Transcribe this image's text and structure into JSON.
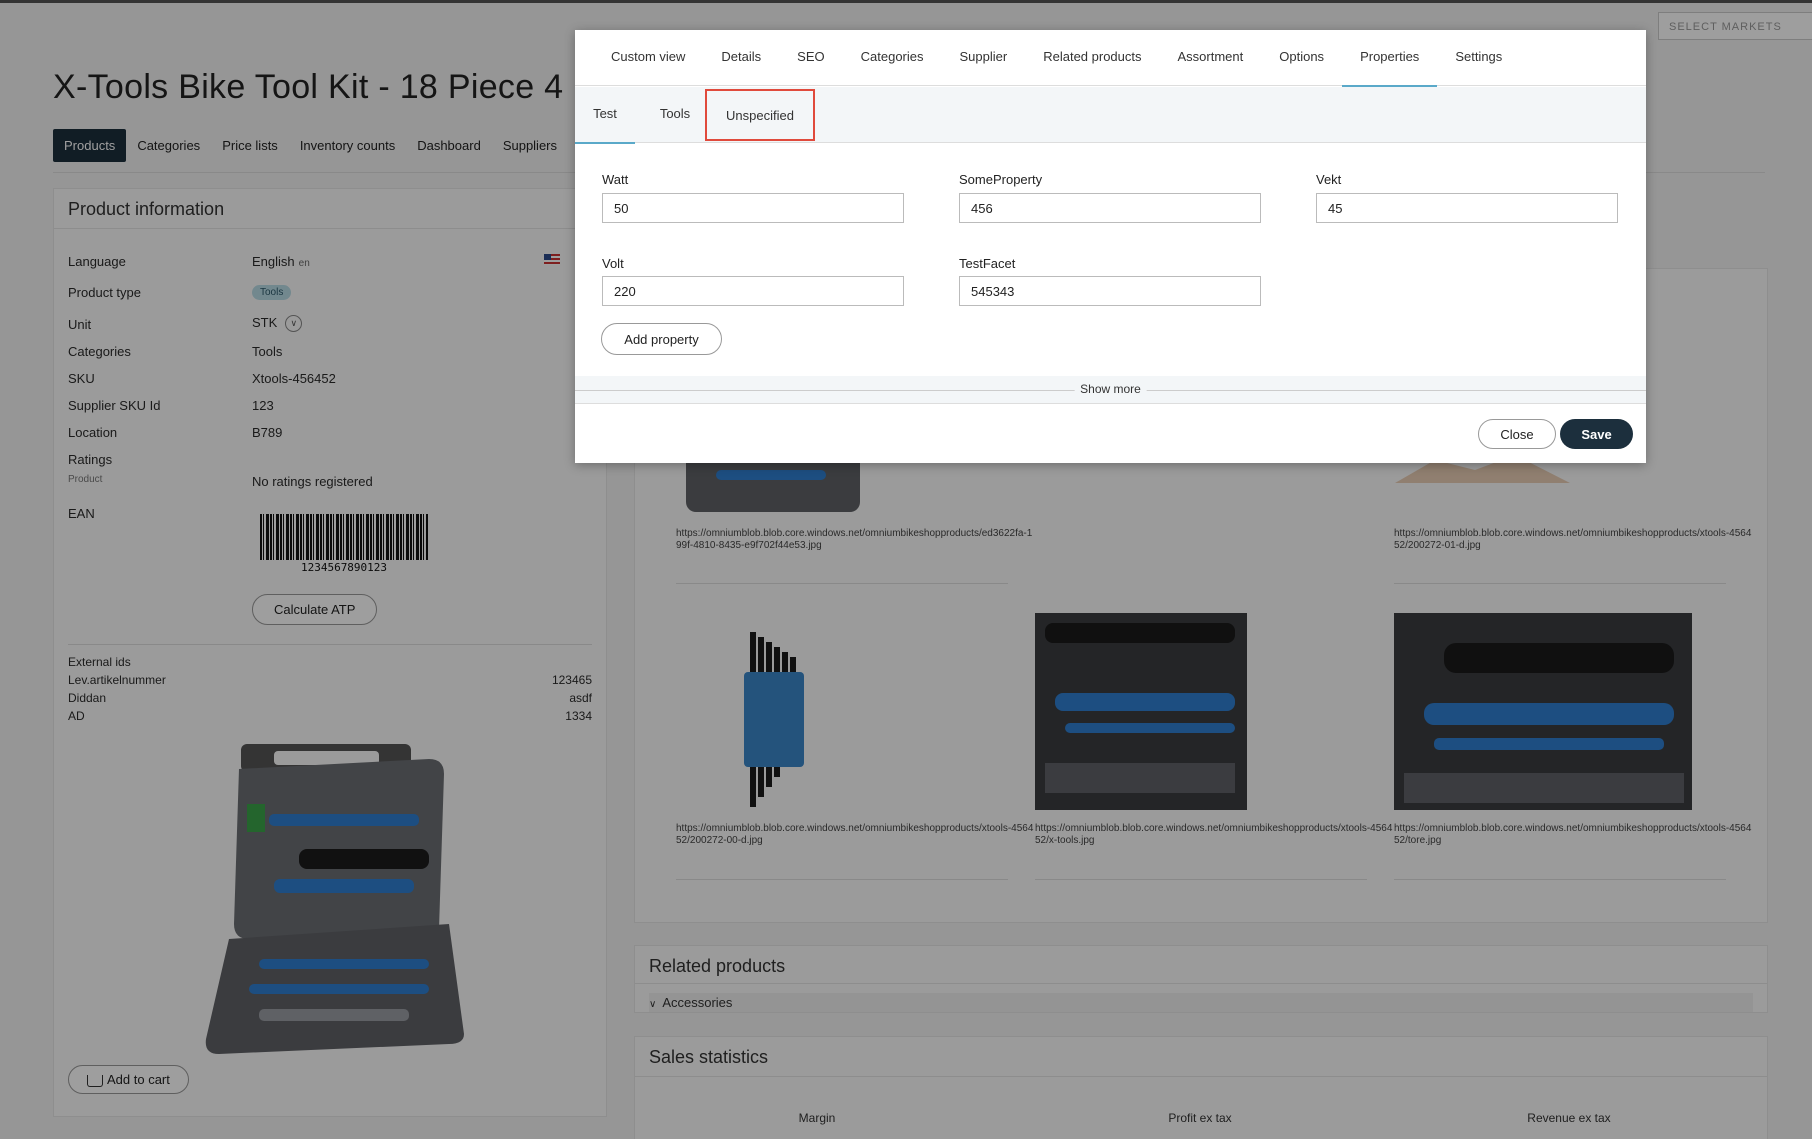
{
  "header": {
    "markets_placeholder": "SELECT MARKETS",
    "title": "X-Tools Bike Tool Kit - 18 Piece 4"
  },
  "nav": {
    "items": [
      "Products",
      "Categories",
      "Price lists",
      "Inventory counts",
      "Dashboard",
      "Suppliers"
    ],
    "active": "Products"
  },
  "product_info": {
    "heading": "Product information",
    "language_label": "Language",
    "language_value": "English",
    "language_code": "en",
    "product_type_label": "Product type",
    "product_type_value": "Tools",
    "unit_label": "Unit",
    "unit_value": "STK",
    "categories_label": "Categories",
    "categories_value": "Tools",
    "sku_label": "SKU",
    "sku_value": "Xtools-456452",
    "supplier_sku_label": "Supplier SKU Id",
    "supplier_sku_value": "123",
    "location_label": "Location",
    "location_value": "B789",
    "ratings_label": "Ratings",
    "ratings_sub_label": "Product",
    "ratings_value": "No ratings registered",
    "ean_label": "EAN",
    "ean_value": "1234567890123",
    "calculate_atp": "Calculate ATP",
    "external_ids_label": "External ids",
    "external_ids": [
      {
        "key": "Lev.artikelnummer",
        "value": "123465"
      },
      {
        "key": "Diddan",
        "value": "asdf"
      },
      {
        "key": "AD",
        "value": "1334"
      }
    ],
    "add_to_cart": "Add to cart"
  },
  "images": [
    {
      "url": "https://omniumblob.blob.core.windows.net/omniumbikeshopproducts/ed3622fa-199f-4810-8435-e9f702f44e53.jpg"
    },
    {
      "url": "https://omniumblob.blob.core.windows.net/omniumbikeshopproducts/xtools-456452/200272-01-d.jpg"
    },
    {
      "url": "https://omniumblob.blob.core.windows.net/omniumbikeshopproducts/xtools-456452/200272-00-d.jpg"
    },
    {
      "url": "https://omniumblob.blob.core.windows.net/omniumbikeshopproducts/xtools-456452/x-tools.jpg"
    },
    {
      "url": "https://omniumblob.blob.core.windows.net/omniumbikeshopproducts/xtools-456452/tore.jpg"
    }
  ],
  "related_products": {
    "heading": "Related products",
    "accessories": "Accessories"
  },
  "sales_statistics": {
    "heading": "Sales statistics",
    "margin": "Margin",
    "profit": "Profit ex tax",
    "revenue": "Revenue ex tax"
  },
  "modal": {
    "tabs": [
      "Custom view",
      "Details",
      "SEO",
      "Categories",
      "Supplier",
      "Related products",
      "Assortment",
      "Options",
      "Properties",
      "Settings"
    ],
    "active_tab": "Properties",
    "subtabs": [
      "Test",
      "Tools",
      "Unspecified"
    ],
    "active_subtab": "Test",
    "highlighted_subtab": "Unspecified",
    "properties": [
      {
        "label": "Watt",
        "value": "50"
      },
      {
        "label": "SomeProperty",
        "value": "456"
      },
      {
        "label": "Vekt",
        "value": "45"
      },
      {
        "label": "Volt",
        "value": "220"
      },
      {
        "label": "TestFacet",
        "value": "545343"
      }
    ],
    "add_property": "Add property",
    "show_more": "Show more",
    "close": "Close",
    "save": "Save"
  }
}
